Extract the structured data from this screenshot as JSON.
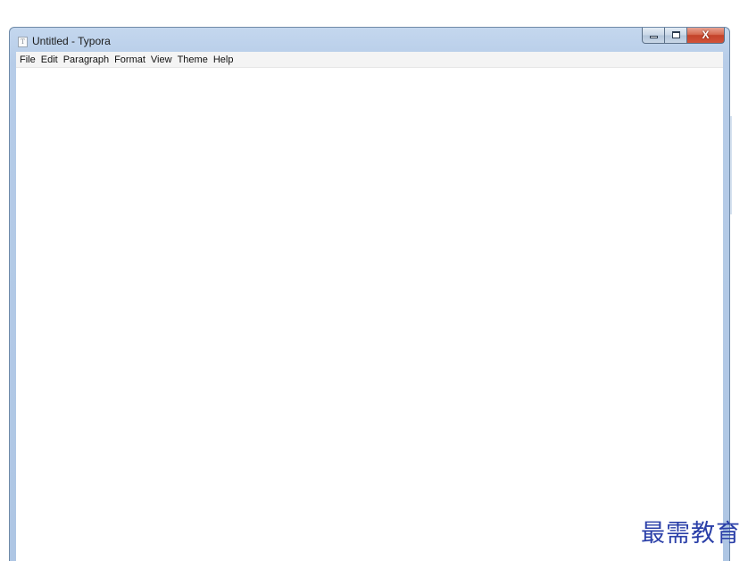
{
  "window": {
    "title": "Untitled - Typora",
    "icon": "typora-app-icon",
    "icon_glyph": "T",
    "close_glyph": "X"
  },
  "menu": {
    "items": [
      "File",
      "Edit",
      "Paragraph",
      "Format",
      "View",
      "Theme",
      "Help"
    ]
  },
  "editor": {
    "content": ""
  },
  "watermark": {
    "text": "最需教育"
  },
  "colors": {
    "titlebar": "#b6cce8",
    "close_button": "#c3432a",
    "watermark": "#2a3fa8"
  }
}
